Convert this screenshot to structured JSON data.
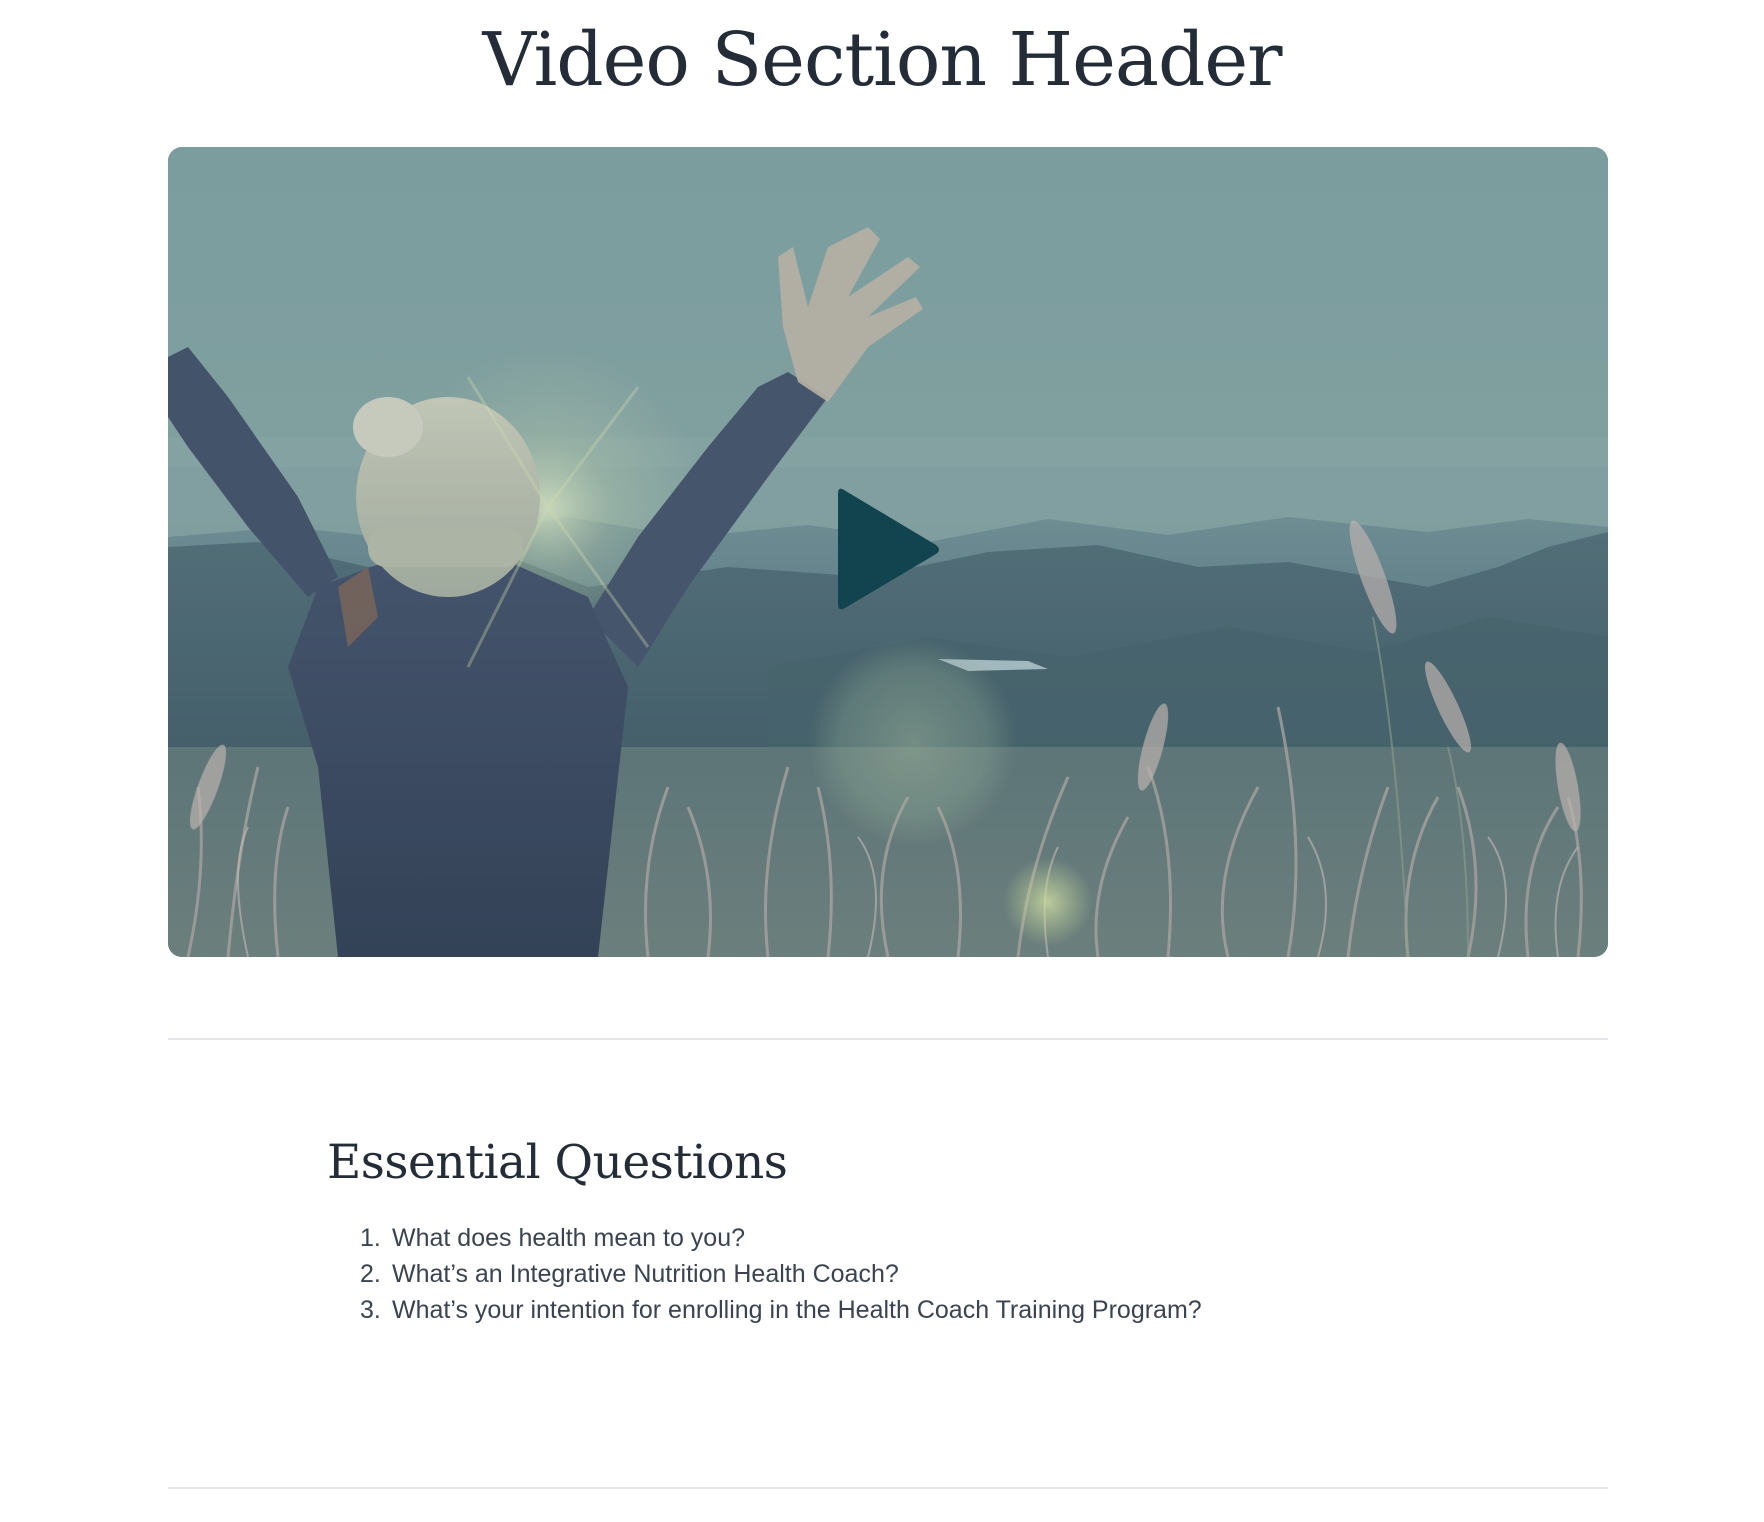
{
  "header": {
    "title": "Video Section Header"
  },
  "video": {
    "play_icon": "play-icon",
    "play_color": "#12444f",
    "overlay_tint": "#6f9497"
  },
  "essential_questions": {
    "heading": "Essential Questions",
    "items": [
      {
        "number": "1.",
        "text": "What does health mean to you?"
      },
      {
        "number": "2.",
        "text": "What’s an Integrative Nutrition Health Coach?"
      },
      {
        "number": "3.",
        "text": "What’s your intention for enrolling in the Health Coach Training Program?"
      }
    ]
  }
}
